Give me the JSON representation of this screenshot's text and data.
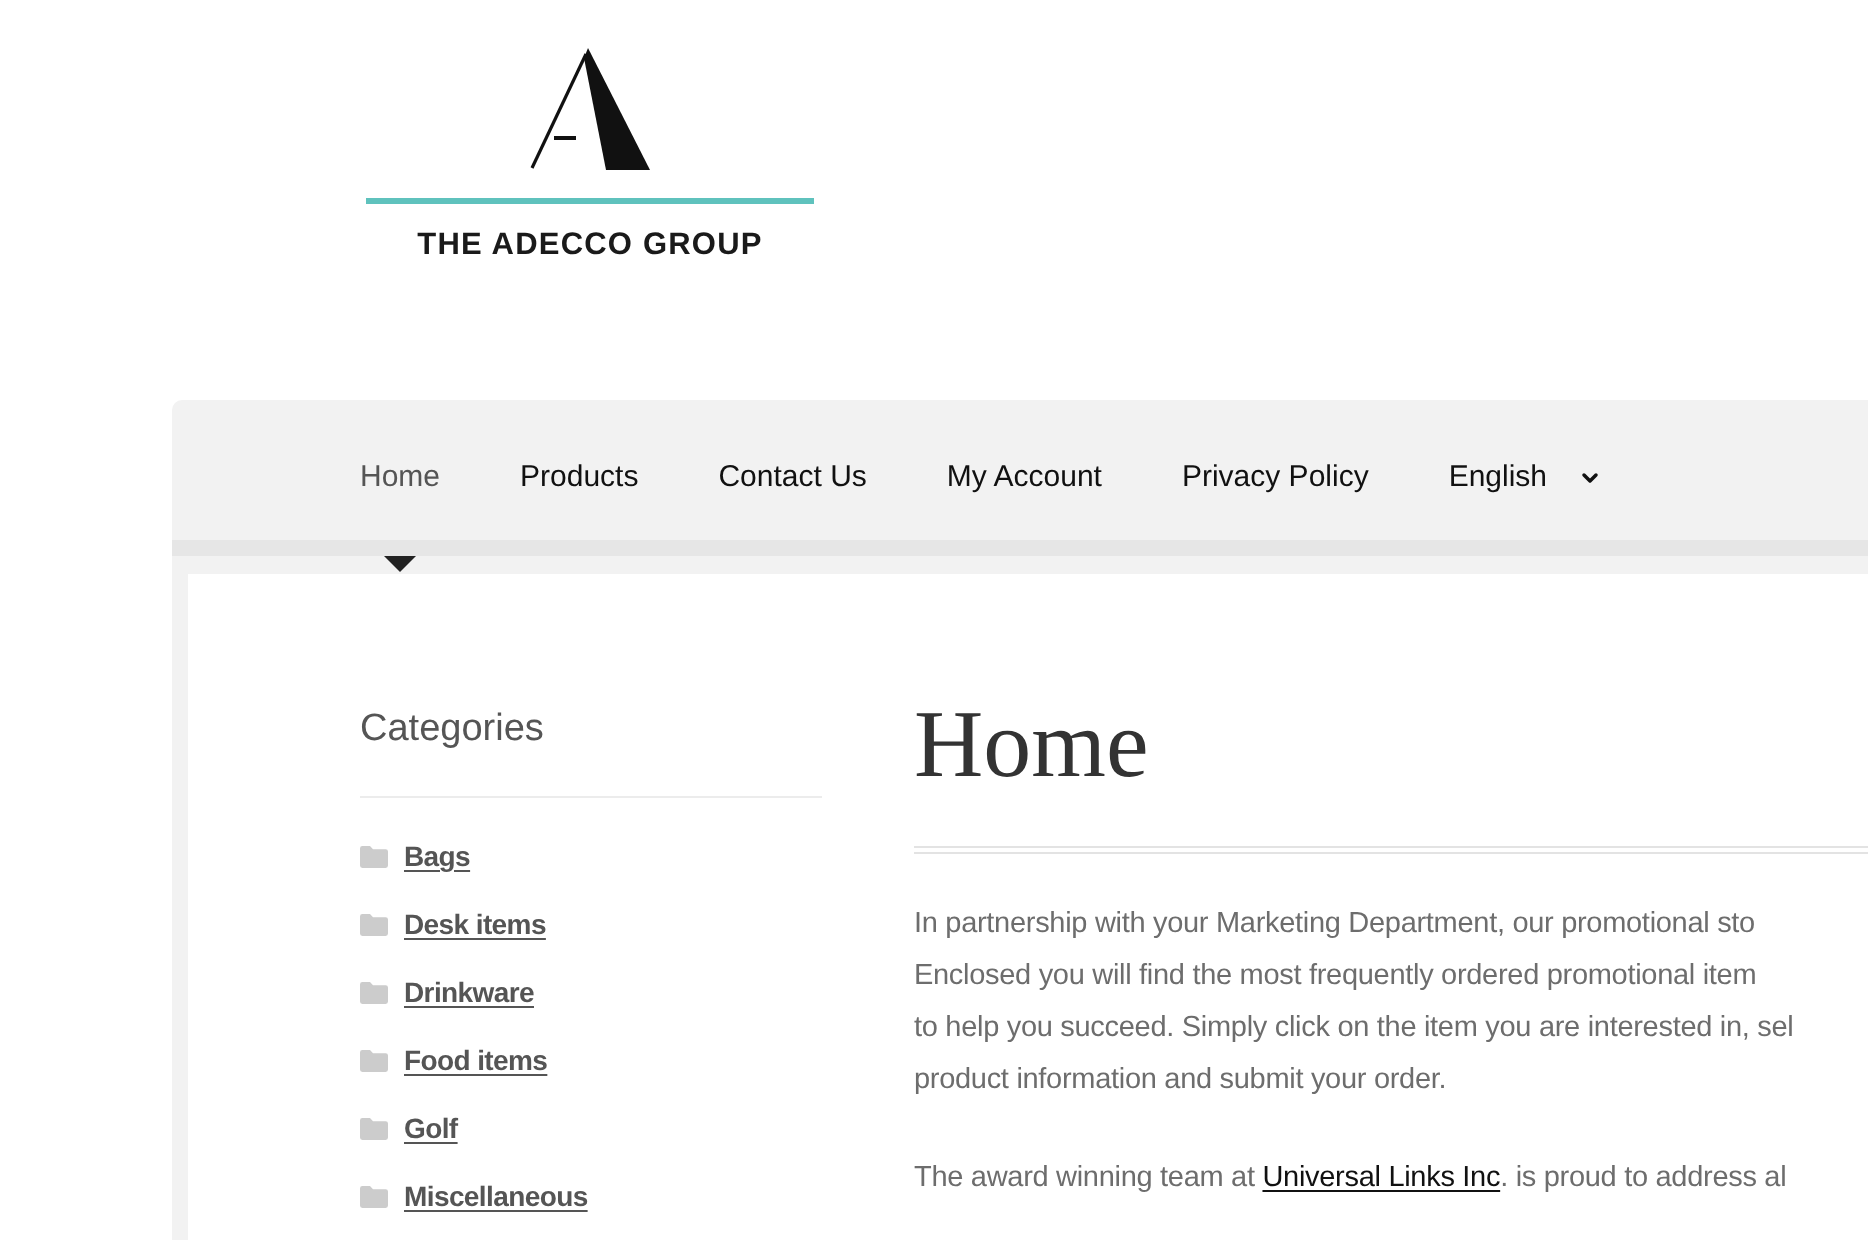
{
  "logo": {
    "text": "THE ADECCO GROUP"
  },
  "nav": {
    "items": [
      {
        "label": "Home",
        "selected": true
      },
      {
        "label": "Products",
        "selected": false
      },
      {
        "label": "Contact Us",
        "selected": false
      },
      {
        "label": "My Account",
        "selected": false
      },
      {
        "label": "Privacy Policy",
        "selected": false
      }
    ],
    "language": {
      "label": "English"
    }
  },
  "sidebar": {
    "title": "Categories",
    "items": [
      "Bags",
      "Desk items",
      "Drinkware",
      "Food items",
      "Golf",
      "Miscellaneous"
    ]
  },
  "content": {
    "title": "Home",
    "paragraph_1": [
      "In partnership with your Marketing Department, our promotional sto",
      "Enclosed you will find the most frequently ordered promotional item",
      "to help you succeed. Simply click on the item you are interested in, sel",
      "product information and submit your order."
    ],
    "paragraph_2": {
      "before": "The award winning team at ",
      "link": "Universal Links Inc",
      "after": ". is proud to address al"
    }
  }
}
